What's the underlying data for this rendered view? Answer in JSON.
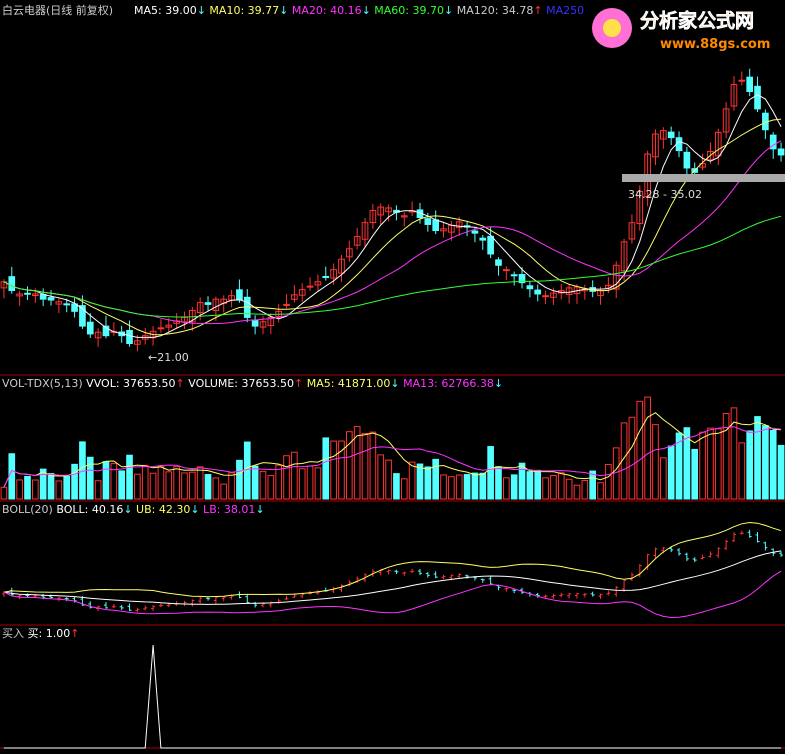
{
  "stock": {
    "name": "白云电器",
    "period": "(日线 前复权)"
  },
  "ma_header": [
    {
      "label": "MA5: 39.00",
      "arrow": "↓",
      "color": "#ffffff"
    },
    {
      "label": "MA10: 39.77",
      "arrow": "↓",
      "color": "#ffff66"
    },
    {
      "label": "MA20: 40.16",
      "arrow": "↓",
      "color": "#ff33ff"
    },
    {
      "label": "MA60: 39.70",
      "arrow": "↓",
      "color": "#33ff33"
    },
    {
      "label": "MA120: 34.78",
      "arrow": "↑",
      "color": "#cccccc"
    },
    {
      "label": "MA250",
      "arrow": "",
      "color": "#3333ff"
    }
  ],
  "logo": {
    "title": "分析家公式网",
    "url": "www.88gs.com"
  },
  "annotations": {
    "low_label": "←21.00",
    "range_label": "34.28 - 35.02"
  },
  "vol_header": [
    {
      "label": "VOL-TDX(5,13)",
      "arrow": "",
      "color": "#cccccc"
    },
    {
      "label": "VVOL: 37653.50",
      "arrow": "↑",
      "color": "#ffffff"
    },
    {
      "label": "VOLUME: 37653.50",
      "arrow": "↑",
      "color": "#ffffff"
    },
    {
      "label": "MA5: 41871.00",
      "arrow": "↓",
      "color": "#ffff66"
    },
    {
      "label": "MA13: 62766.38",
      "arrow": "↓",
      "color": "#ff33ff"
    }
  ],
  "boll_header": [
    {
      "label": "BOLL(20)",
      "arrow": "",
      "color": "#cccccc"
    },
    {
      "label": "BOLL: 40.16",
      "arrow": "↓",
      "color": "#ffffff"
    },
    {
      "label": "UB: 42.30",
      "arrow": "↓",
      "color": "#ffff66"
    },
    {
      "label": "LB: 38.01",
      "arrow": "↓",
      "color": "#ff33ff"
    }
  ],
  "buy_header": [
    {
      "label": "买入",
      "arrow": "",
      "color": "#cccccc"
    },
    {
      "label": "买: 1.00",
      "arrow": "↑",
      "color": "#ffffff"
    }
  ],
  "colors": {
    "up": "#ff3333",
    "down": "#54ffff",
    "grid": "#aa0000"
  },
  "chart_data": {
    "type": "candlestick",
    "close": [
      32.0,
      31.0,
      30.6,
      30.6,
      30.6,
      30.0,
      29.9,
      29.7,
      29.4,
      28.6,
      26.9,
      26.0,
      26.2,
      25.8,
      26.3,
      25.8,
      24.9,
      25.2,
      25.8,
      26.3,
      26.7,
      27.0,
      27.5,
      27.9,
      28.7,
      29.6,
      29.4,
      30.0,
      30.0,
      30.4,
      29.9,
      27.9,
      26.9,
      27.4,
      27.9,
      28.6,
      29.4,
      30.5,
      31.1,
      31.5,
      32.0,
      32.5,
      33.4,
      34.6,
      35.8,
      37.2,
      38.8,
      40.2,
      40.6,
      40.5,
      40.0,
      39.6,
      40.2,
      39.4,
      38.6,
      37.9,
      38.1,
      38.5,
      38.9,
      38.3,
      37.6,
      36.8,
      35.2,
      33.9,
      33.4,
      32.7,
      31.9,
      31.2,
      30.6,
      30.4,
      30.7,
      31.0,
      31.3,
      31.4,
      31.2,
      30.9,
      31.0,
      31.6,
      33.9,
      36.6,
      38.8,
      42.4,
      46.7,
      49.0,
      49.4,
      48.6,
      47.1,
      45.1,
      44.6,
      45.6,
      47.0,
      49.2,
      51.9,
      54.7,
      55.2,
      53.9,
      51.9,
      49.5,
      47.3,
      46.6
    ],
    "buy_signal": [
      0,
      0,
      0,
      0,
      0,
      0,
      0,
      0,
      0,
      0,
      0,
      0,
      0,
      0,
      0,
      0,
      0,
      0,
      0,
      0,
      0,
      0,
      0,
      0,
      0,
      0,
      0,
      0,
      0,
      0,
      0,
      0,
      0,
      0,
      0,
      0,
      0,
      0,
      0,
      0,
      0,
      0,
      0,
      0,
      0,
      0,
      0,
      0,
      0,
      0,
      0,
      0,
      0,
      0,
      0,
      0,
      0,
      0,
      0,
      0,
      0,
      0,
      0,
      0,
      0,
      0,
      0,
      0,
      0,
      0,
      0,
      0,
      0,
      0,
      0,
      0,
      0,
      0,
      0,
      0,
      0,
      0,
      0,
      0,
      0,
      0,
      0,
      0,
      0,
      0,
      0,
      0,
      0,
      0,
      0,
      0,
      0,
      0,
      0,
      0
    ],
    "buy_signal_index": 19,
    "low_point": 21.0
  }
}
